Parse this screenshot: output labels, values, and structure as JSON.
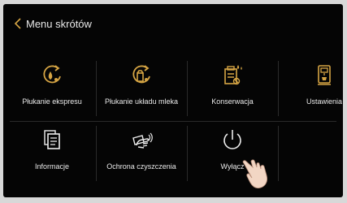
{
  "header": {
    "title": "Menu skrótów"
  },
  "colors": {
    "accent": "#d6a544",
    "background": "#050505",
    "text": "#ededed"
  },
  "tiles": [
    {
      "label": "Płukanie ekspresu",
      "icon": "rinse-coffee-system-icon"
    },
    {
      "label": "Płukanie układu mleka",
      "icon": "rinse-milk-system-icon"
    },
    {
      "label": "Konserwacja",
      "icon": "maintenance-icon"
    },
    {
      "label": "Ustawienia",
      "icon": "settings-machine-icon"
    },
    {
      "label": "Informacje",
      "icon": "information-icon"
    },
    {
      "label": "Ochrona czyszczenia",
      "icon": "cleaning-lock-icon"
    },
    {
      "label": "Wyłącz",
      "icon": "power-icon"
    }
  ]
}
